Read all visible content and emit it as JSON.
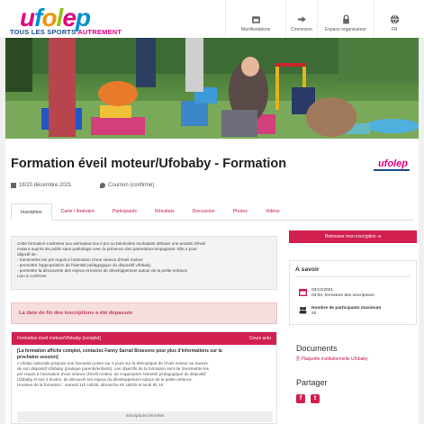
{
  "header": {
    "logo_text": "ufolep",
    "tagline_main": "TOUS LES SPORTS",
    "tagline_accent": "AUTREMENT",
    "nav": [
      {
        "label": "Manifestations",
        "icon": "calendar-icon"
      },
      {
        "label": "Connexion",
        "icon": "login-icon"
      },
      {
        "label": "Espace organisateur",
        "icon": "lock-icon"
      },
      {
        "label": "FR",
        "icon": "globe-icon"
      }
    ]
  },
  "event": {
    "title": "Formation éveil moteur/Ufobaby - Formation",
    "partner_logo": "ufolep",
    "date": "18/20 décembre 2021",
    "location": "Coumon (confirmé)"
  },
  "tabs": [
    "Inscription",
    "Carte / Itinéraire",
    "Participants",
    "Résultats",
    "Discussion",
    "Photos",
    "Vidéos"
  ],
  "description": [
    "Cette formation s'adresse aux animateur.rice.s pro ou bénévoles souhaitant débuter une activité d'éveil",
    "moteur auprès de public sans pathologie avec la présence des parents/accompagnant. Elle a pour",
    "objectif de :",
    "- transmettre les pré requis à l'animation d'une séance d'éveil moteur",
    "- permettre l'appropriation de l'identité pédagogique du dispositif Ufobaby",
    "- permettre la découverte des enjeux et leviers de développement autour de la petite enfance",
    "Lieu à confirmer"
  ],
  "alert": "La date de fin des inscriptions a été dépassée",
  "session": {
    "title": "Formation éveil moteur/Ufobaby [complet]",
    "link": "Cours actu",
    "bold_lines": [
      "[La formation affiche complet, contactez Fanny Sarrail Brassens pour plus d'informations sur la",
      "prochaine session]"
    ],
    "lines": [
      "L'Ufolep nationale propose une formation jolote sur 3 jours sur la thématique de l'éveil moteur au travers",
      "de son dispositif Ufobaby (pratique parents/enfants). Les objectifs de la formation sont de transmettre les",
      "pré requis à l'animation d'une séance d'éveil moteur, de s'approprier l'identité pédagogique du dispositif",
      "Ufobaby et ses 4 leviers, de découvrir les enjeux du développement autour de la petite enfance.",
      "Horaires de la formation : samedi 11h 18h30, dimanche 9h 18h30 et lundi 9h 15"
    ],
    "closed_label": "Inscriptions fermées"
  },
  "sidebar": {
    "register_button": "Retrouver mon inscription",
    "asavoir_title": "A savoir",
    "deadline_date": "03/12/2021",
    "deadline_text": "03:00, fermeture des inscriptions",
    "max_label": "Nombre de participants maximum",
    "max_value": "20",
    "documents_title": "Documents",
    "document_link": "Plaquette institutionnelle Ufobaby",
    "share_title": "Partager"
  },
  "colors": {
    "accent": "#d11f4f",
    "brand_magenta": "#e6007e",
    "brand_blue": "#1d4f91"
  }
}
